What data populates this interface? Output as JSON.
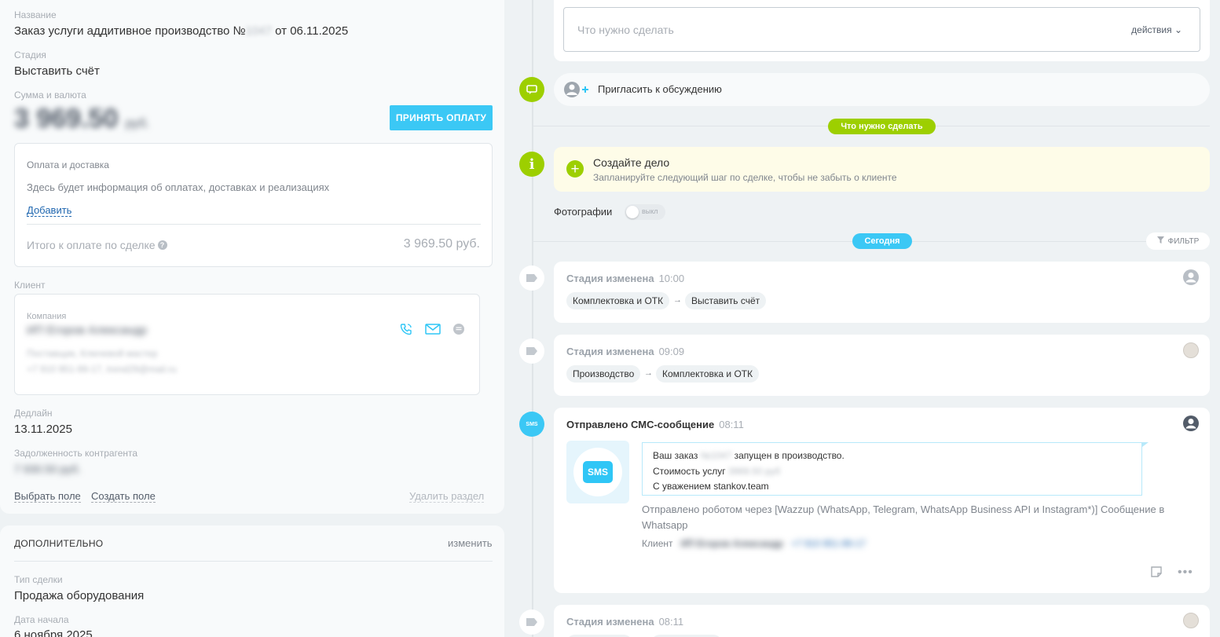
{
  "deal": {
    "name_label": "Название",
    "name_prefix": "Заказ услуги аддитивное производство №",
    "name_number": "1047",
    "name_suffix": "от 06.11.2025",
    "stage_label": "Стадия",
    "stage_value": "Выставить счёт",
    "amount_label": "Сумма и валюта",
    "amount_value": "3 969.50",
    "amount_currency": "руб.",
    "pay_button": "ПРИНЯТЬ ОПЛАТУ"
  },
  "payment": {
    "title": "Оплата и доставка",
    "info": "Здесь будет информация об оплатах, доставках и реализациях",
    "add_link": "Добавить",
    "total_label": "Итого к оплате по сделке",
    "total_value": "3 969.50 руб."
  },
  "client": {
    "section_label": "Клиент",
    "company_label": "Компания",
    "company_name": "ИП Егоров Александр",
    "company_type": "Поставщик, Ключевой мастер",
    "contacts": "+7 910 951-99-17, trend29@mail.ru"
  },
  "deadline": {
    "label": "Дедлайн",
    "value": "13.11.2025"
  },
  "debt": {
    "label": "Задолженность контрагента",
    "value": "7 930.50 руб."
  },
  "field_links": {
    "select": "Выбрать поле",
    "create": "Создать поле",
    "delete": "Удалить раздел"
  },
  "additional": {
    "title": "ДОПОЛНИТЕЛЬНО",
    "edit": "изменить",
    "deal_type_label": "Тип сделки",
    "deal_type_value": "Продажа оборудования",
    "start_date_label": "Дата начала",
    "start_date_value": "6 ноября 2025"
  },
  "timeline": {
    "todo_placeholder": "Что нужно сделать",
    "actions_label": "действия",
    "invite_label": "Пригласить к обсуждению",
    "todo_pill": "Что нужно сделать",
    "create_task_title": "Создайте дело",
    "create_task_hint": "Запланируйте следующий шаг по сделке, чтобы не забыть о клиенте",
    "photos_label": "Фотографии",
    "photos_toggle": "выкл",
    "today_pill": "Сегодня",
    "filter_label": "ФИЛЬТР",
    "events": [
      {
        "title": "Стадия изменена",
        "time": "10:00",
        "from": "Комплектовка и ОТК",
        "to": "Выставить счёт"
      },
      {
        "title": "Стадия изменена",
        "time": "09:09",
        "from": "Производство",
        "to": "Комплектовка и ОТК"
      },
      {
        "title": "Стадия изменена",
        "time": "08:11"
      }
    ],
    "sms": {
      "title": "Отправлено СМС-сообщение",
      "time": "08:11",
      "badge": "SMS",
      "line1_a": "Ваш заказ ",
      "line1_num": "№1047",
      "line1_b": " запущен в производство.",
      "line2_a": "Стоимость услуг ",
      "line2_cost": "3969.50 руб",
      "line3": "С уважением stankov.team",
      "robot_note": "Отправлено роботом через [Wazzup (WhatsApp, Telegram, WhatsApp Business API и Instagram*)] Сообщение в Whatsapp",
      "client_label": "Клиент",
      "client_name": "ИП Егоров Александр",
      "client_phone": "+7 910 951-99-17"
    }
  },
  "colors": {
    "accent": "#3bc8f5",
    "green": "#9dcf00",
    "link": "#2067b0"
  }
}
